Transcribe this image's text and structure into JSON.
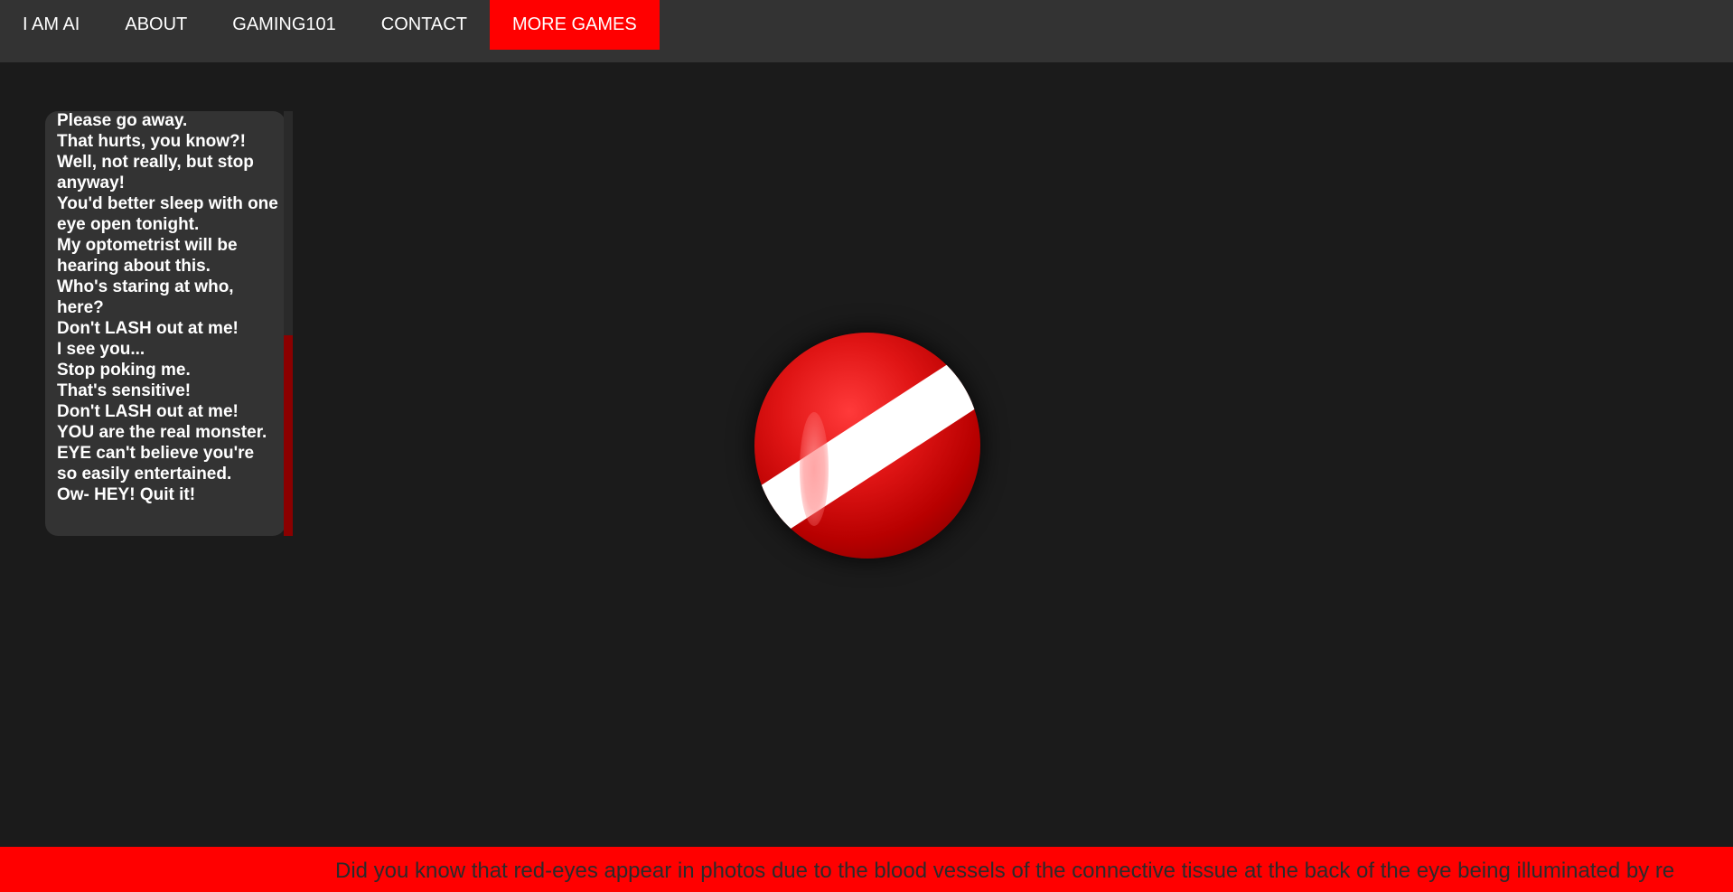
{
  "nav": {
    "items": [
      {
        "label": "I AM AI"
      },
      {
        "label": "ABOUT"
      },
      {
        "label": "GAMING101"
      },
      {
        "label": "CONTACT"
      },
      {
        "label": "MORE GAMES",
        "active": true
      }
    ]
  },
  "log": {
    "lines": [
      "Please go away.",
      "That hurts, you know?!",
      "Well, not really, but stop anyway!",
      "You'd better sleep with one eye open tonight.",
      "My optometrist will be hearing about this.",
      "Who's staring at who, here?",
      "Don't LASH out at me!",
      "I see you...",
      "Stop poking me.",
      "That's sensitive!",
      "Don't LASH out at me!",
      "YOU are the real monster.",
      "EYE can't believe you're so easily entertained.",
      "Ow- HEY! Quit it!"
    ]
  },
  "ticker": {
    "text": "Did you know that red-eyes appear in photos due to the blood vessels of the connective tissue at the back of the eye being illuminated by re"
  },
  "colors": {
    "accent": "#ff0000",
    "nav_bg": "#333333",
    "page_bg": "#1b1b1b",
    "scrollbar_thumb": "#8b0000"
  }
}
